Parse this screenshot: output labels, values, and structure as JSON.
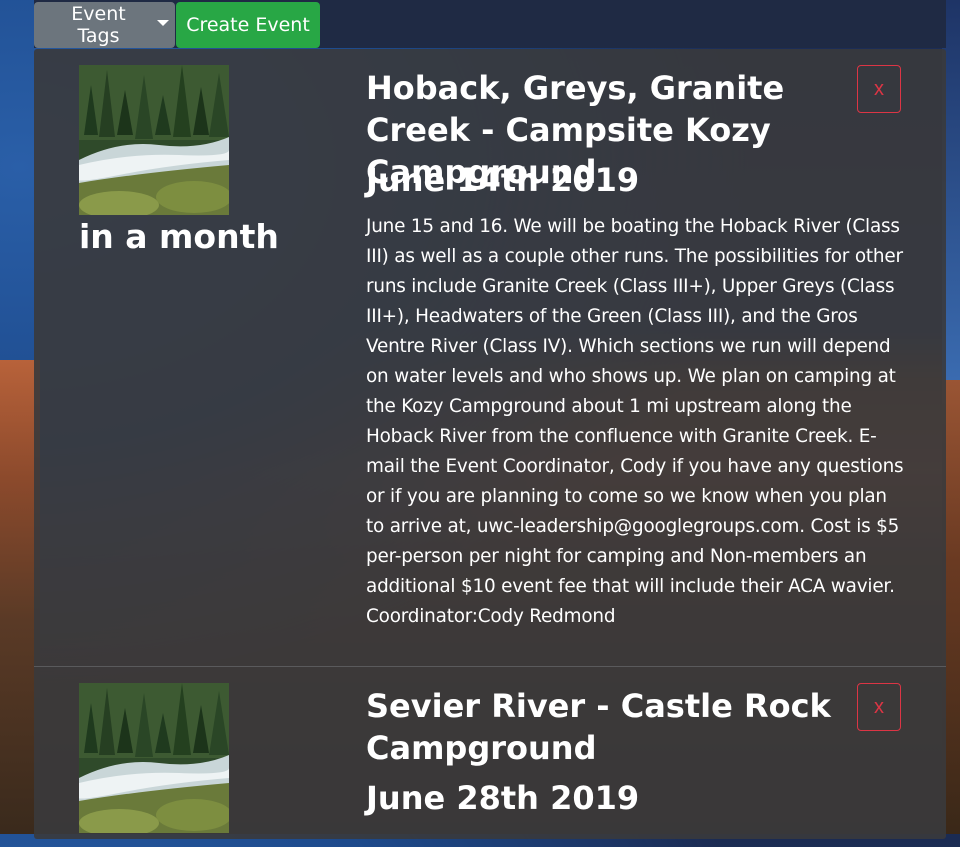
{
  "toolbar": {
    "event_tags_label": "Event Tags",
    "create_event_label": "Create Event"
  },
  "events": [
    {
      "relative_time": "in a month",
      "title": "Hoback, Greys, Granite Creek - Campsite Kozy Campground",
      "date": "June 14th 2019",
      "description": "June 15 and 16. We will be boating the Hoback River (Class III) as well as a couple other runs. The possibilities for other runs include Granite Creek (Class III+), Upper Greys (Class III+), Headwaters of the Green (Class III), and the Gros Ventre River (Class IV). Which sections we run will depend on water levels and who shows up. We plan on camping at the Kozy Campground about 1 mi upstream along the Hoback River from the confluence with Granite Creek. E-mail the Event Coordinator, Cody if you have any questions or if you are planning to come so we know when you plan to arrive at, uwc-leadership@googlegroups.com. Cost is $5 per-person per night for camping and Non-members an additional $10 event fee that will include their ACA wavier. Coordinator:Cody Redmond",
      "delete_label": "x"
    },
    {
      "title": "Sevier River - Castle Rock Campground",
      "date": "June 28th 2019",
      "delete_label": "x"
    }
  ],
  "colors": {
    "success": "#28a745",
    "secondary": "#6c757d",
    "danger": "#dc3545"
  }
}
